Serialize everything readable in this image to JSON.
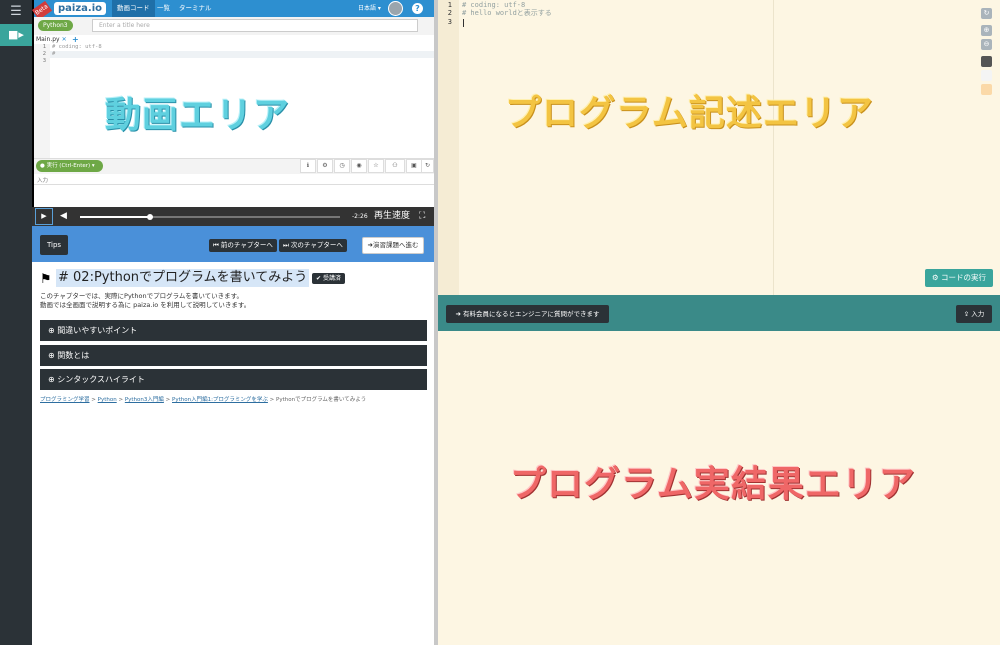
{
  "video_player": {
    "header": {
      "beta_badge": "Beta",
      "logo": "paiza.io",
      "nav_active": "動画コード",
      "nav_list": "一覧",
      "nav_terminal": "ターミナル",
      "language": "日本語 ▾"
    },
    "language_button": "Python3",
    "title_placeholder": "Enter a title here",
    "file_tab": "Main.py",
    "mini_editor_lines": [
      "# coding: utf-8",
      "#",
      ""
    ],
    "run_button": "実行 (Ctrl-Enter)",
    "input_label": "入力",
    "time_remaining": "-2:26",
    "speed_label": "再生速度",
    "progress": 0.27
  },
  "overlay_labels": {
    "video_area": "動画エリア",
    "editor_area": "プログラム記述エリア",
    "output_area": "プログラム実結果エリア"
  },
  "lesson": {
    "tips_button": "Tips",
    "prev_chapter": "前のチャプターへ",
    "next_chapter": "次のチャプターへ",
    "exercise_button": "演習課題へ進む",
    "chapter_title": "# 02:Pythonでプログラムを書いてみよう",
    "completed_badge": "受講済",
    "intro_line1": "このチャプターでは、実際にPythonでプログラムを書いていきます。",
    "intro_line2": "動画では全画面で説明する為に paiza.io を利用して説明していきます。",
    "accordion": [
      "間違いやすいポイント",
      "関数とは",
      "シンタックスハイライト"
    ],
    "breadcrumb": {
      "links": [
        "プログラミング学習",
        "Python",
        "Python3入門編",
        "Python入門編1:プログラミングを学ぶ"
      ],
      "separator": ">",
      "current": "Pythonでプログラムを書いてみよう"
    }
  },
  "editor": {
    "lines": [
      {
        "n": "1",
        "text": "# coding: utf-8"
      },
      {
        "n": "2",
        "text": "# hello worldと表示する"
      },
      {
        "n": "3",
        "text": ""
      }
    ],
    "run_code_button": "コードの実行",
    "colors": {
      "background": "#fdf6e3",
      "accent": "#3aa59c"
    }
  },
  "output": {
    "question_button": "有料会員になるとエンジニアに質問ができます",
    "input_button": "入力"
  }
}
